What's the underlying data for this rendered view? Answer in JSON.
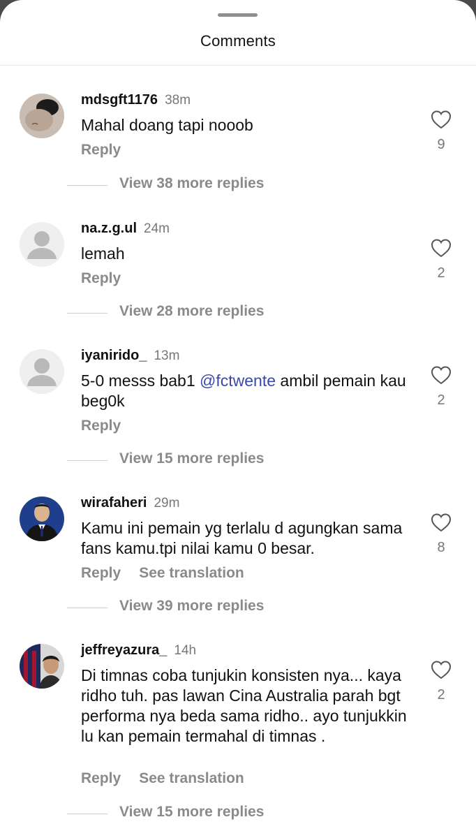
{
  "header": {
    "title": "Comments"
  },
  "labels": {
    "reply": "Reply",
    "see_translation": "See translation"
  },
  "comments": [
    {
      "username": "mdsgft1176",
      "time": "38m",
      "text": "Mahal doang tapi nooob",
      "likes": "9",
      "view_replies": "View 38 more replies",
      "avatar": "photo-dark-hair"
    },
    {
      "username": "na.z.g.ul",
      "time": "24m",
      "text": "lemah",
      "likes": "2",
      "view_replies": "View 28 more replies",
      "avatar": "default-person"
    },
    {
      "username": "iyanirido_",
      "time": "13m",
      "text_before": "5-0 messs bab1 ",
      "mention": "@fctwente",
      "text_after": " ambil pemain kau beg0k",
      "likes": "2",
      "view_replies": "View 15 more replies",
      "avatar": "default-person"
    },
    {
      "username": "wirafaheri",
      "time": "29m",
      "text": "Kamu ini pemain yg terlalu d agungkan sama fans kamu.tpi nilai kamu 0 besar.",
      "likes": "8",
      "view_replies": "View 39 more replies",
      "avatar": "photo-suit"
    },
    {
      "username": "jeffreyazura_",
      "time": "14h",
      "text": "Di timnas coba tunjukin konsisten nya... kaya ridho tuh. pas lawan Cina Australia parah bgt performa nya beda sama ridho.. ayo tunjukkin lu kan pemain termahal di timnas .",
      "likes": "2",
      "view_replies": "View 15 more replies",
      "avatar": "photo-jersey"
    }
  ],
  "colors": {
    "mention": "#3949ab",
    "secondary_text": "#8a8a8a",
    "primary_text": "#111111"
  }
}
